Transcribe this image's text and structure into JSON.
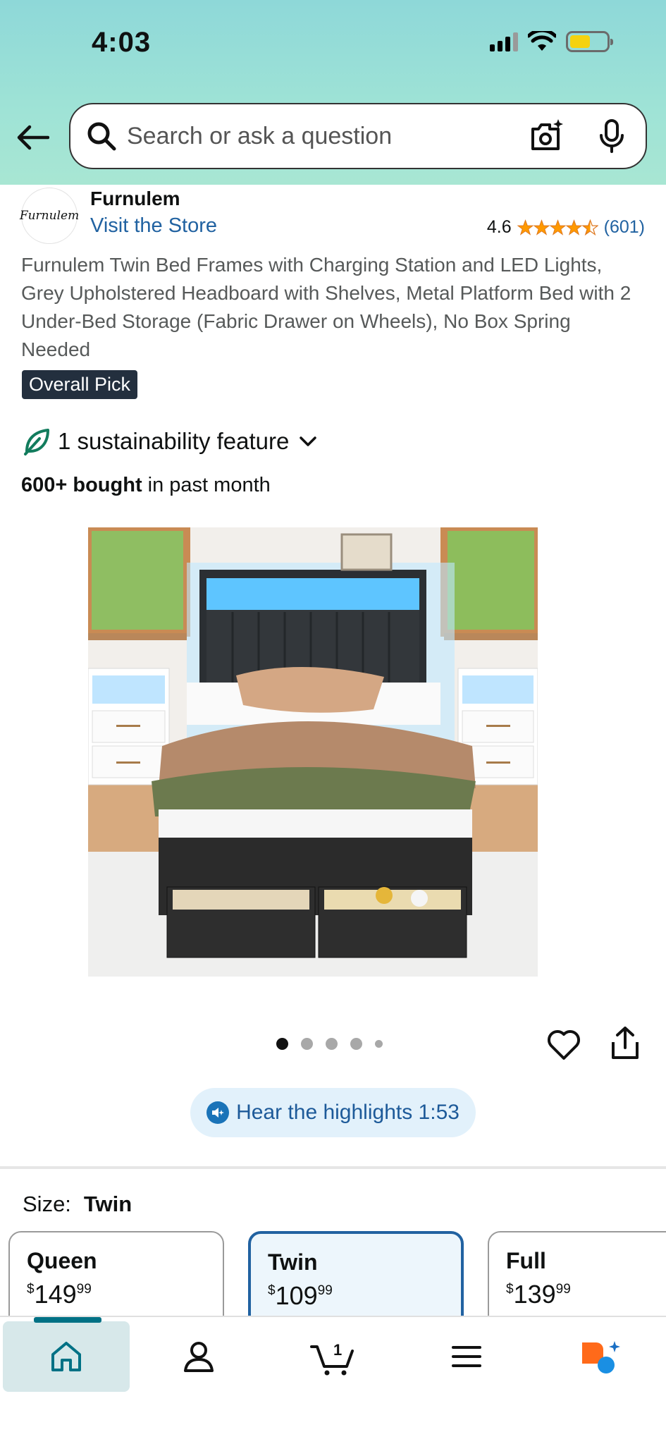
{
  "status_bar": {
    "time": "4:03"
  },
  "search": {
    "placeholder": "Search or ask a question"
  },
  "brand": {
    "logo_text": "Furnulem",
    "name": "Furnulem",
    "visit_store": "Visit the Store"
  },
  "rating": {
    "value": "4.6",
    "stars": 4.5,
    "count": "(601)"
  },
  "product": {
    "title": "Furnulem Twin Bed Frames with Charging Station and LED Lights, Grey Upholstered Headboard with Shelves, Metal Platform Bed with 2 Under-Bed Storage (Fabric Drawer on Wheels), No Box Spring Needed",
    "badge": "Overall Pick",
    "sustainability": "1 sustainability feature",
    "bought_count": "600+ bought",
    "bought_suffix": "in past month"
  },
  "gallery": {
    "total_dots": 5,
    "active_index": 0
  },
  "highlights": {
    "label": "Hear the highlights 1:53"
  },
  "size": {
    "label": "Size:",
    "selected": "Twin",
    "options": [
      {
        "name": "Queen",
        "currency": "$",
        "dollars": "149",
        "cents": "99"
      },
      {
        "name": "Twin",
        "currency": "$",
        "dollars": "109",
        "cents": "99"
      },
      {
        "name": "Full",
        "currency": "$",
        "dollars": "139",
        "cents": "99"
      }
    ]
  },
  "tabbar": {
    "items": [
      {
        "icon": "home-icon"
      },
      {
        "icon": "account-icon"
      },
      {
        "icon": "cart-icon",
        "badge": "1"
      },
      {
        "icon": "menu-icon"
      },
      {
        "icon": "rufus-icon"
      }
    ]
  },
  "colors": {
    "header_teal": "#9fe3d6",
    "link_blue": "#2162a1",
    "star_orange": "#ff9900",
    "badge_dark": "#232f3e",
    "battery_yellow": "#f4d20f"
  }
}
